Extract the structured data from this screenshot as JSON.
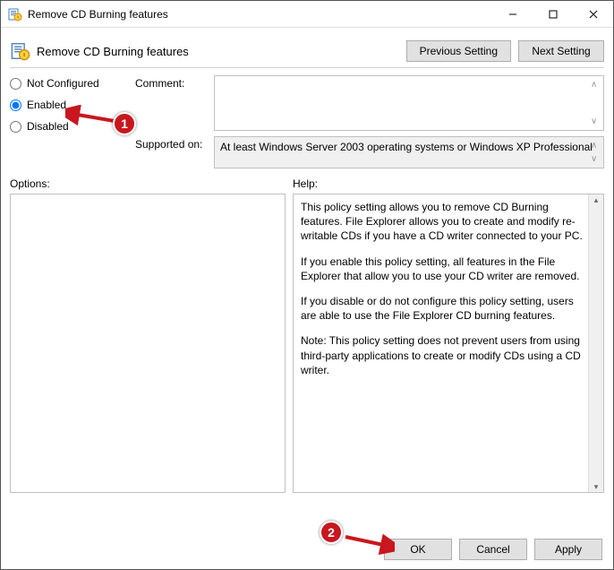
{
  "window": {
    "title": "Remove CD Burning features"
  },
  "header": {
    "title": "Remove CD Burning features",
    "prev_btn": "Previous Setting",
    "next_btn": "Next Setting"
  },
  "radios": {
    "not_configured": "Not Configured",
    "enabled": "Enabled",
    "disabled": "Disabled",
    "selected": "enabled"
  },
  "fields": {
    "comment_label": "Comment:",
    "comment_value": "",
    "supported_label": "Supported on:",
    "supported_value": "At least Windows Server 2003 operating systems or Windows XP Professional"
  },
  "panels": {
    "options_label": "Options:",
    "help_label": "Help:",
    "help_paragraphs": [
      "This policy setting allows you to remove CD Burning features. File Explorer allows you to create and modify re-writable CDs if you have a CD writer connected to your PC.",
      "If you enable this policy setting, all features in the File Explorer that allow you to use your CD writer are removed.",
      "If you disable or do not configure this policy setting, users are able to use the File Explorer CD burning features.",
      "Note: This policy setting does not prevent users from using third-party applications to create or modify CDs using a CD writer."
    ]
  },
  "footer": {
    "ok": "OK",
    "cancel": "Cancel",
    "apply": "Apply"
  },
  "annotations": {
    "badge1": "1",
    "badge2": "2"
  }
}
